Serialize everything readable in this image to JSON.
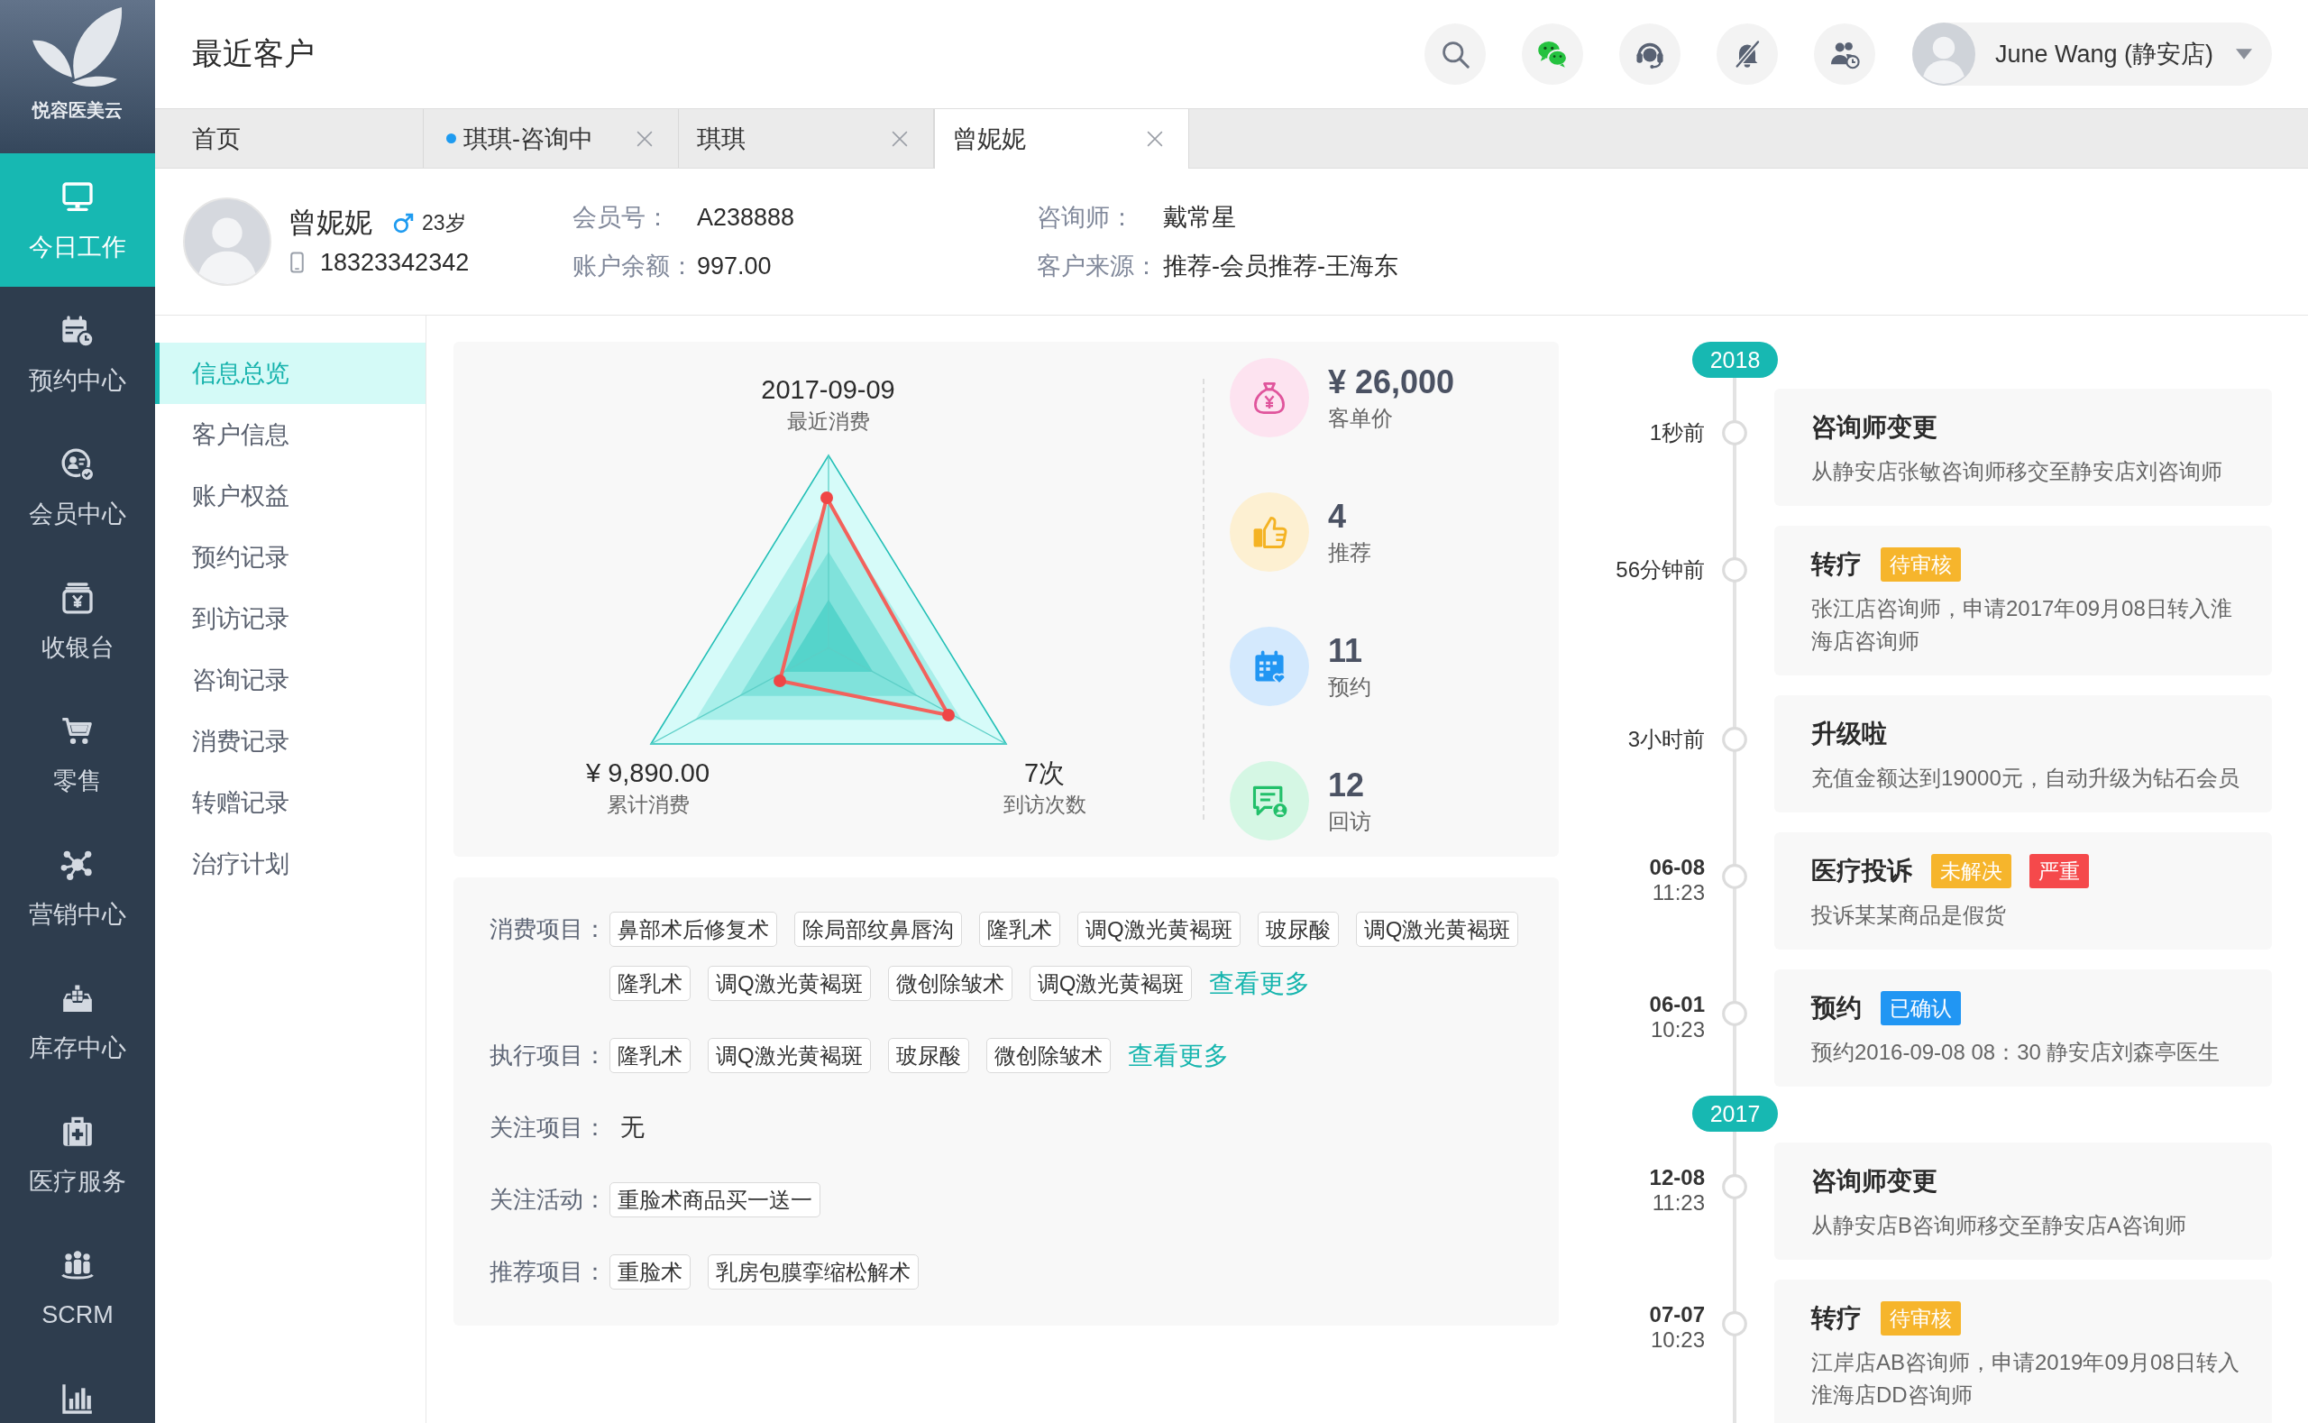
{
  "sidebar": {
    "logo_text": "悦容医美云",
    "items": [
      {
        "label": "今日工作",
        "selected": true
      },
      {
        "label": "预约中心",
        "selected": false
      },
      {
        "label": "会员中心",
        "selected": false
      },
      {
        "label": "收银台",
        "selected": false
      },
      {
        "label": "零售",
        "selected": false
      },
      {
        "label": "营销中心",
        "selected": false
      },
      {
        "label": "库存中心",
        "selected": false
      },
      {
        "label": "医疗服务",
        "selected": false
      },
      {
        "label": "SCRM",
        "selected": false
      },
      {
        "selected": false
      }
    ]
  },
  "header": {
    "title": "最近客户",
    "user": {
      "name": "June Wang (静安店)"
    }
  },
  "tabs": [
    {
      "label": "首页",
      "dot": false,
      "closable": false,
      "selected": false
    },
    {
      "label": "琪琪-咨询中",
      "dot": true,
      "closable": true,
      "selected": false
    },
    {
      "label": "琪琪",
      "dot": false,
      "closable": true,
      "selected": false
    },
    {
      "label": "曾妮妮",
      "dot": false,
      "closable": true,
      "selected": true
    }
  ],
  "customer": {
    "name": "曾妮妮",
    "male": true,
    "age": "23岁",
    "phone": "18323342342",
    "fields": [
      {
        "label": "会员号：",
        "value": "A238888"
      },
      {
        "label": "咨询师：",
        "value": "戴常星"
      },
      {
        "label": "账户余额：",
        "value": "997.00"
      },
      {
        "label": "客户来源：",
        "value": "推荐-会员推荐-王海东"
      }
    ]
  },
  "submenu": [
    {
      "label": "信息总览",
      "selected": true
    },
    {
      "label": "客户信息",
      "selected": false
    },
    {
      "label": "账户权益",
      "selected": false
    },
    {
      "label": "预约记录",
      "selected": false
    },
    {
      "label": "到访记录",
      "selected": false
    },
    {
      "label": "咨询记录",
      "selected": false
    },
    {
      "label": "消费记录",
      "selected": false
    },
    {
      "label": "转赠记录",
      "selected": false
    },
    {
      "label": "治疗计划",
      "selected": false
    }
  ],
  "overview": {
    "radar_axes": [
      {
        "value": "2017-09-09",
        "label": "最近消费"
      },
      {
        "value": "¥ 9,890.00",
        "label": "累计消费"
      },
      {
        "value": "7次",
        "label": "到访次数"
      }
    ],
    "stats": [
      {
        "value": "¥ 26,000",
        "label": "客单价"
      },
      {
        "value": "4",
        "label": "推荐"
      },
      {
        "value": "11",
        "label": "预约"
      },
      {
        "value": "12",
        "label": "回访"
      }
    ]
  },
  "projects": [
    {
      "label": "消费项目：",
      "tags": [
        "鼻部术后修复术",
        "除局部纹鼻唇沟",
        "隆乳术",
        "调Q激光黄褐斑",
        "玻尿酸",
        "调Q激光黄褐斑",
        "隆乳术",
        "调Q激光黄褐斑",
        "微创除皱术",
        "调Q激光黄褐斑"
      ],
      "more": "查看更多"
    },
    {
      "label": "执行项目：",
      "tags": [
        "隆乳术",
        "调Q激光黄褐斑",
        "玻尿酸",
        "微创除皱术"
      ],
      "more": "查看更多"
    },
    {
      "label": "关注项目：",
      "text": "无"
    },
    {
      "label": "关注活动：",
      "tags": [
        "重脸术商品买一送一"
      ]
    },
    {
      "label": "推荐项目：",
      "tags": [
        "重脸术",
        "乳房包膜挛缩松解术"
      ]
    }
  ],
  "timeline": [
    {
      "year": "2018",
      "entries": [
        {
          "ago": "1秒前",
          "title": "咨询师变更",
          "body": "从静安店张敏咨询师移交至静安店刘咨询师"
        },
        {
          "ago": "56分钟前",
          "title": "转疗",
          "badges": [
            {
              "text": "待审核",
              "color": "#f6b52c"
            }
          ],
          "body": "张江店咨询师，申请2017年09月08日转入淮海店咨询师"
        },
        {
          "ago": "3小时前",
          "title": "升级啦",
          "body": "充值金额达到19000元，自动升级为钻石会员"
        },
        {
          "date": "06-08",
          "time": "11:23",
          "title": "医疗投诉",
          "badges": [
            {
              "text": "未解决",
              "color": "#f6b52c"
            },
            {
              "text": "严重",
              "color": "#f5494b"
            }
          ],
          "body": "投诉某某商品是假货"
        },
        {
          "date": "06-01",
          "time": "10:23",
          "title": "预约",
          "badges": [
            {
              "text": "已确认",
              "color": "#2196f3"
            }
          ],
          "body": "预约2016-09-08 08：30 静安店刘森亭医生"
        }
      ]
    },
    {
      "year": "2017",
      "entries": [
        {
          "date": "12-08",
          "time": "11:23",
          "title": "咨询师变更",
          "body": "从静安店B咨询师移交至静安店A咨询师"
        },
        {
          "date": "07-07",
          "time": "10:23",
          "title": "转疗",
          "badges": [
            {
              "text": "待审核",
              "color": "#f6b52c"
            }
          ],
          "body": "江岸店AB咨询师，申请2019年09月08日转入淮海店DD咨询师"
        }
      ]
    }
  ]
}
